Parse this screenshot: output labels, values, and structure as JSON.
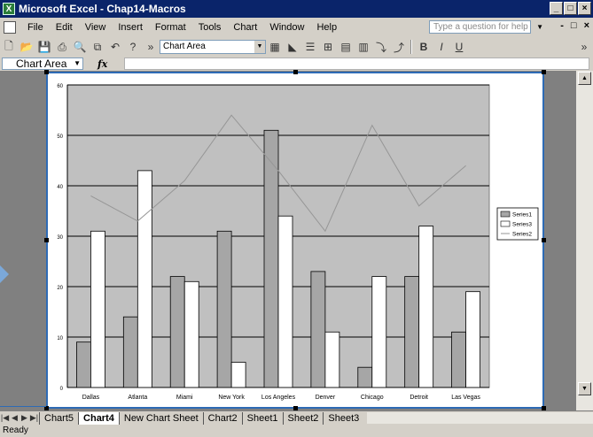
{
  "window": {
    "title": "Microsoft Excel - Chap14-Macros",
    "app_icon": "excel-icon",
    "minimize": "_",
    "maximize": "□",
    "close": "×"
  },
  "menu": {
    "items": [
      "File",
      "Edit",
      "View",
      "Insert",
      "Format",
      "Tools",
      "Chart",
      "Window",
      "Help"
    ],
    "help_placeholder": "Type a question for help",
    "mdi_buttons": [
      "-",
      "□",
      "×"
    ]
  },
  "toolbar": {
    "chart_object": "Chart Area",
    "more": "»"
  },
  "formula_bar": {
    "name_box": "Chart Area",
    "fx": "fx"
  },
  "sheets": {
    "tabs": [
      "Chart5",
      "Chart4",
      "New Chart Sheet",
      "Chart2",
      "Sheet1",
      "Sheet2",
      "Sheet3"
    ],
    "active": "Chart4"
  },
  "status": {
    "text": "Ready"
  },
  "chart_data": {
    "type": "bar",
    "categories": [
      "Dallas",
      "Atlanta",
      "Miami",
      "New York",
      "Los Angeles",
      "Denver",
      "Chicago",
      "Detroit",
      "Las Vegas"
    ],
    "series": [
      {
        "name": "Series1",
        "type": "bar",
        "color": "#a6a6a6",
        "values": [
          9,
          14,
          22,
          31,
          51,
          23,
          4,
          22,
          11
        ]
      },
      {
        "name": "Series3",
        "type": "bar",
        "color": "#ffffff",
        "values": [
          31,
          43,
          21,
          5,
          34,
          11,
          22,
          32,
          19
        ]
      },
      {
        "name": "Series2",
        "type": "line",
        "color": "#969696",
        "values": [
          38,
          33,
          41,
          54,
          43,
          31,
          52,
          36,
          44
        ]
      }
    ],
    "legend": [
      "Series1",
      "Series3",
      "Series2"
    ],
    "legend_position": "right",
    "ylim": [
      0,
      60
    ],
    "yticks": [
      0,
      10,
      20,
      30,
      40,
      50,
      60
    ],
    "plot_background": "#c0c0c0",
    "grid": true
  }
}
